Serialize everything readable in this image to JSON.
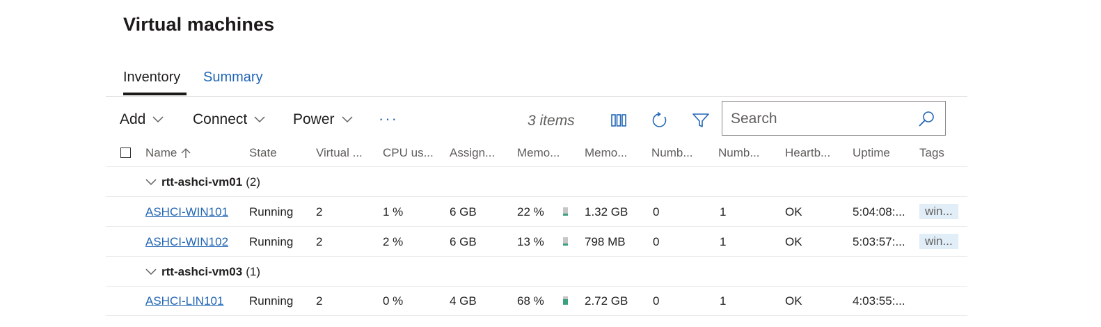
{
  "page": {
    "title": "Virtual machines"
  },
  "tabs": [
    {
      "label": "Inventory",
      "active": true
    },
    {
      "label": "Summary",
      "active": false
    }
  ],
  "toolbar": {
    "add_label": "Add",
    "connect_label": "Connect",
    "power_label": "Power",
    "more_label": "···",
    "items_count": "3 items",
    "search_placeholder": "Search"
  },
  "columns": [
    "Name",
    "State",
    "Virtual ...",
    "CPU us...",
    "Assign...",
    "Memo...",
    "Memo...",
    "Numb...",
    "Numb...",
    "Heartb...",
    "Uptime",
    "Tags"
  ],
  "groups": [
    {
      "name": "rtt-ashci-vm01",
      "count": "(2)",
      "rows": [
        {
          "name": "ASHCI-WIN101",
          "state": "Running",
          "vcpus": "2",
          "cpu": "1 %",
          "assigned": "6 GB",
          "mem_pct": "22 %",
          "mem_level": 0.22,
          "mem_demand": "1.32 GB",
          "num1": "0",
          "num2": "1",
          "heartbeat": "OK",
          "uptime": "5:04:08:...",
          "tags": "win..."
        },
        {
          "name": "ASHCI-WIN102",
          "state": "Running",
          "vcpus": "2",
          "cpu": "2 %",
          "assigned": "6 GB",
          "mem_pct": "13 %",
          "mem_level": 0.13,
          "mem_demand": "798 MB",
          "num1": "0",
          "num2": "1",
          "heartbeat": "OK",
          "uptime": "5:03:57:...",
          "tags": "win..."
        }
      ]
    },
    {
      "name": "rtt-ashci-vm03",
      "count": "(1)",
      "rows": [
        {
          "name": "ASHCI-LIN101",
          "state": "Running",
          "vcpus": "2",
          "cpu": "0 %",
          "assigned": "4 GB",
          "mem_pct": "68 %",
          "mem_level": 0.68,
          "mem_demand": "2.72 GB",
          "num1": "0",
          "num2": "1",
          "heartbeat": "OK",
          "uptime": "4:03:55:...",
          "tags": ""
        }
      ]
    }
  ],
  "colors": {
    "link": "#2266b5",
    "bar_fill": "#3aa17e",
    "tag_bg": "#e1edf7"
  },
  "icons": {
    "columns": "column-options-icon",
    "refresh": "refresh-icon",
    "filter": "filter-icon",
    "search": "search-icon",
    "sort": "sort-ascending-icon",
    "chevron": "chevron-down-icon"
  }
}
